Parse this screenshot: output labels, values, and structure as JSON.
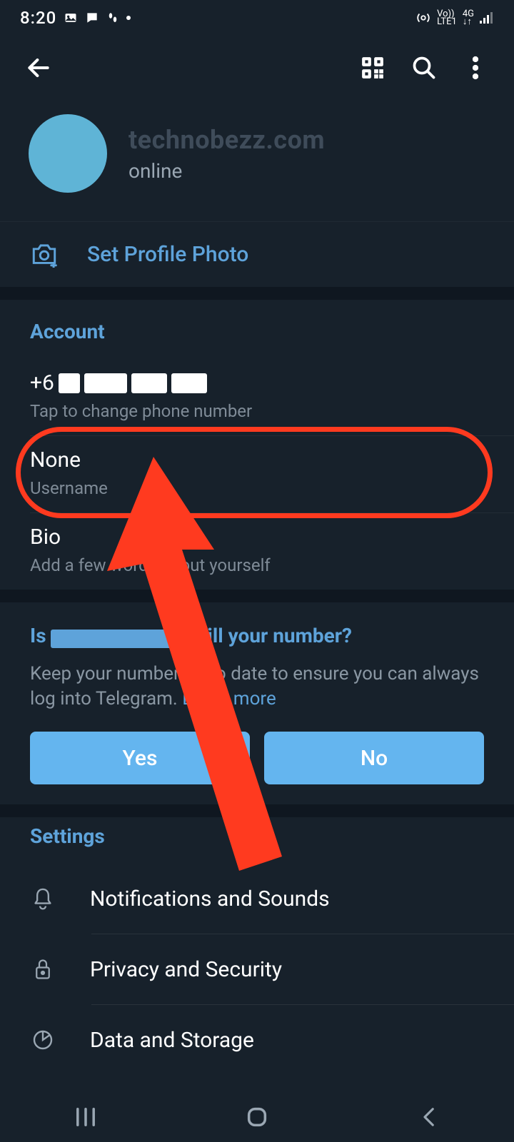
{
  "status": {
    "time": "8:20",
    "net": {
      "volte": "Vo))",
      "lte": "LTE1",
      "gen": "4G"
    }
  },
  "profile": {
    "name": "technobezz.com",
    "status": "online",
    "set_photo": "Set Profile Photo"
  },
  "account": {
    "title": "Account",
    "phone_prefix": "+6",
    "phone_caption": "Tap to change phone number",
    "username_value": "None",
    "username_caption": "Username",
    "bio_value": "Bio",
    "bio_caption": "Add a few words about yourself"
  },
  "prompt": {
    "title_prefix": "Is",
    "title_suffix": "still your number?",
    "body_pre": "Keep your number up to date to ensure you can always log into Telegram. ",
    "learn_more": "Learn more",
    "yes": "Yes",
    "no": "No"
  },
  "settings": {
    "title": "Settings",
    "items": [
      {
        "label": "Notifications and Sounds",
        "icon": "bell"
      },
      {
        "label": "Privacy and Security",
        "icon": "lock"
      },
      {
        "label": "Data and Storage",
        "icon": "pie"
      }
    ]
  }
}
